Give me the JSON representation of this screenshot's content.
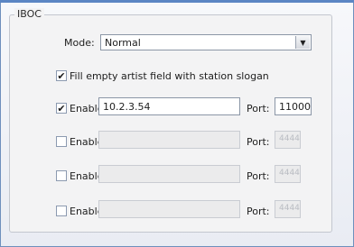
{
  "group": {
    "title": "IBOC"
  },
  "mode": {
    "label": "Mode:",
    "value": "Normal"
  },
  "fill_slogan": {
    "label": "Fill empty artist field with station slogan",
    "checked": true
  },
  "port_label": "Port:",
  "enable_label": "Enable",
  "rows": [
    {
      "checked": true,
      "address": "10.2.3.54",
      "port": "11000",
      "enabled": true
    },
    {
      "checked": false,
      "address": "",
      "port": "4444",
      "enabled": false
    },
    {
      "checked": false,
      "address": "",
      "port": "4444",
      "enabled": false
    },
    {
      "checked": false,
      "address": "",
      "port": "4444",
      "enabled": false
    }
  ]
}
